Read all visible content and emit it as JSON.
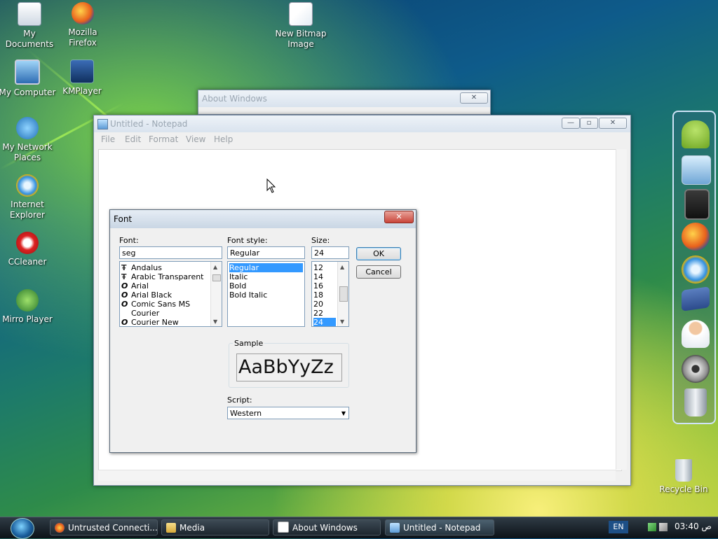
{
  "desktop": {
    "icons": [
      {
        "label": "My Documents",
        "icon": "my-documents-icon"
      },
      {
        "label": "Mozilla Firefox",
        "icon": "firefox-icon"
      },
      {
        "label": "New Bitmap Image",
        "icon": "bitmap-image-icon"
      },
      {
        "label": "My Computer",
        "icon": "my-computer-icon"
      },
      {
        "label": "KMPlayer",
        "icon": "kmplayer-icon"
      },
      {
        "label": "My Network Places",
        "icon": "network-places-icon"
      },
      {
        "label": "Internet Explorer",
        "icon": "internet-explorer-icon"
      },
      {
        "label": "CCleaner",
        "icon": "ccleaner-icon"
      },
      {
        "label": "Mirro Player",
        "icon": "mirro-player-icon"
      },
      {
        "label": "Recycle Bin",
        "icon": "recycle-bin-icon"
      }
    ]
  },
  "about_window": {
    "title": "About Windows",
    "close": "✕"
  },
  "notepad": {
    "title": "Untitled - Notepad",
    "menu": [
      "File",
      "Edit",
      "Format",
      "View",
      "Help"
    ],
    "min": "—",
    "max": "▫",
    "close": "✕"
  },
  "font_dialog": {
    "title": "Font",
    "close": "✕",
    "font_label": "Font:",
    "font_value": "seg",
    "fonts": [
      {
        "name": "Andalus",
        "type": "truetype"
      },
      {
        "name": "Arabic Transparent",
        "type": "truetype"
      },
      {
        "name": "Arial",
        "type": "opentype"
      },
      {
        "name": "Arial Black",
        "type": "opentype"
      },
      {
        "name": "Comic Sans MS",
        "type": "opentype"
      },
      {
        "name": "Courier",
        "type": "none"
      },
      {
        "name": "Courier New",
        "type": "opentype"
      }
    ],
    "style_label": "Font style:",
    "style_value": "Regular",
    "styles": [
      "Regular",
      "Italic",
      "Bold",
      "Bold Italic"
    ],
    "size_label": "Size:",
    "size_value": "24",
    "sizes": [
      "12",
      "14",
      "16",
      "18",
      "20",
      "22",
      "24"
    ],
    "ok": "OK",
    "cancel": "Cancel",
    "sample_label": "Sample",
    "sample_text": "AaBbYyZz",
    "script_label": "Script:",
    "script_value": "Western"
  },
  "taskbar": {
    "start_icon": "windows-orb-icon",
    "buttons": [
      {
        "label": "Untrusted Connecti...",
        "icon": "firefox-icon"
      },
      {
        "label": "Media",
        "icon": "folder-icon"
      },
      {
        "label": "About Windows",
        "icon": "window-icon"
      },
      {
        "label": "Untitled - Notepad",
        "icon": "notepad-icon"
      }
    ],
    "language": "EN",
    "clock": "03:40 ص"
  },
  "dock": {
    "items": [
      "android-icon",
      "computer-network-icon",
      "ipad-icon",
      "firefox-icon",
      "internet-explorer-icon",
      "facebook-icon",
      "support-user-icon",
      "settings-gear-icon",
      "trash-can-icon"
    ]
  },
  "colors": {
    "selection": "#3399ff",
    "close_red": "#c9453a"
  }
}
